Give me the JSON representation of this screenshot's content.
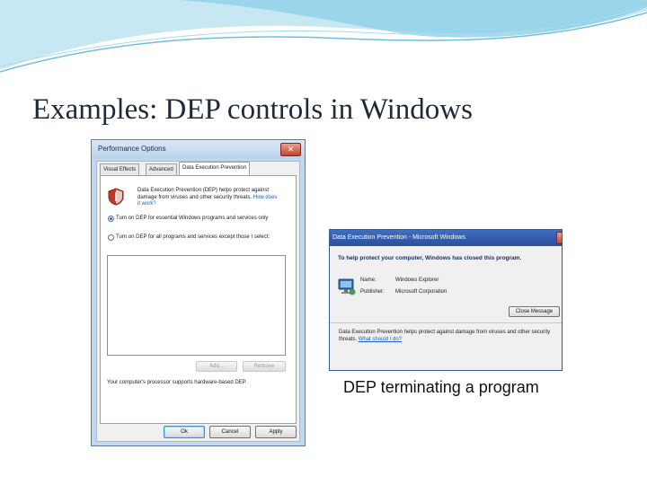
{
  "slide": {
    "title": "Examples: DEP controls in Windows"
  },
  "colors": {
    "wave": "#8fd0e8",
    "title_text": "#1f2a3a",
    "dialog_title": "#2b4f9a",
    "link": "#1a5fc5"
  },
  "performance_options": {
    "title": "Performance Options",
    "close_glyph": "✕",
    "tabs": [
      "Visual Effects",
      "Advanced",
      "Data Execution Prevention"
    ],
    "description": "Data Execution Prevention (DEP) helps protect against damage from viruses and other security threats.",
    "help_link": "How does it work?",
    "radio_essential": "Turn on DEP for essential Windows programs and services only",
    "radio_all": "Turn on DEP for all programs and services except those I select:",
    "add_button": "Add...",
    "remove_button": "Remove",
    "hardware_note": "Your computer's processor supports hardware-based DEP.",
    "ok_button": "Ok",
    "cancel_button": "Cancel",
    "apply_button": "Apply",
    "icons": [
      "shield-icon"
    ]
  },
  "dep_dialog": {
    "title": "Data Execution Prevention - Microsoft Windows",
    "heading": "To help protect your computer, Windows has closed this program.",
    "name_label": "Name:",
    "name_value": "Windows Explorer",
    "publisher_label": "Publisher:",
    "publisher_value": "Microsoft Corporation",
    "close_button": "Close Message",
    "info": "Data Execution Prevention helps protect against damage from viruses and other security threats.",
    "info_link": "What should I do?",
    "icons": [
      "computer-icon"
    ]
  },
  "caption": "DEP terminating a program"
}
